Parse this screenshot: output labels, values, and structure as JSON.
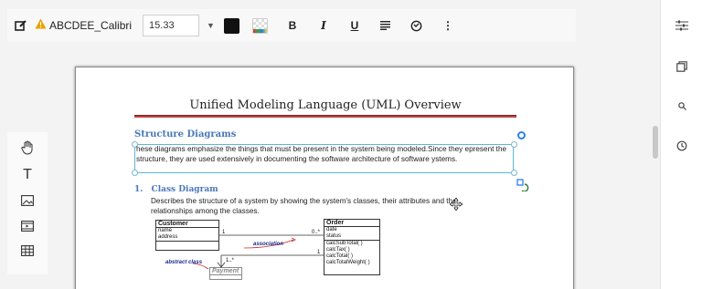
{
  "toolbar": {
    "font_name": "ABCDEE_Calibri",
    "font_size": "15.33",
    "text_color": "#111111",
    "format_bold": "B",
    "format_italic": "I",
    "format_underline": "U"
  },
  "document": {
    "title": "Unified Modeling Language (UML) Overview",
    "section_heading": "Structure Diagrams",
    "paragraph": "hese diagrams emphasize the things that must be present in the system being modeled.Since they epresent the structure, they are used extensively in documenting the software architecture of software ystems.",
    "item_number": "1.",
    "item_heading": "Class Diagram",
    "item_desc": "Describes the structure of a system by showing the system's classes, their attributes and the relationships among the classes."
  },
  "uml": {
    "customer": {
      "title": "Customer",
      "attrs": [
        "name",
        "address"
      ]
    },
    "order": {
      "title": "Order",
      "attrs": [
        "date",
        "status"
      ],
      "ops": [
        "calcSubTotal( )",
        "calcTax( )",
        "calcTotal( )",
        "calcTotalWeight( )"
      ]
    },
    "payment": {
      "title": "Payment"
    },
    "label_association": "association",
    "label_abstract": "abstract class",
    "mult_one": "1",
    "mult_many": "0..*",
    "mult_one_b": "1",
    "mult_one_many": "1..*"
  },
  "icons": {
    "edit": "edit-icon",
    "warning": "warning-icon",
    "settings": "sliders-icon",
    "copy": "copy-icon",
    "search": "search-icon",
    "history": "history-icon"
  }
}
